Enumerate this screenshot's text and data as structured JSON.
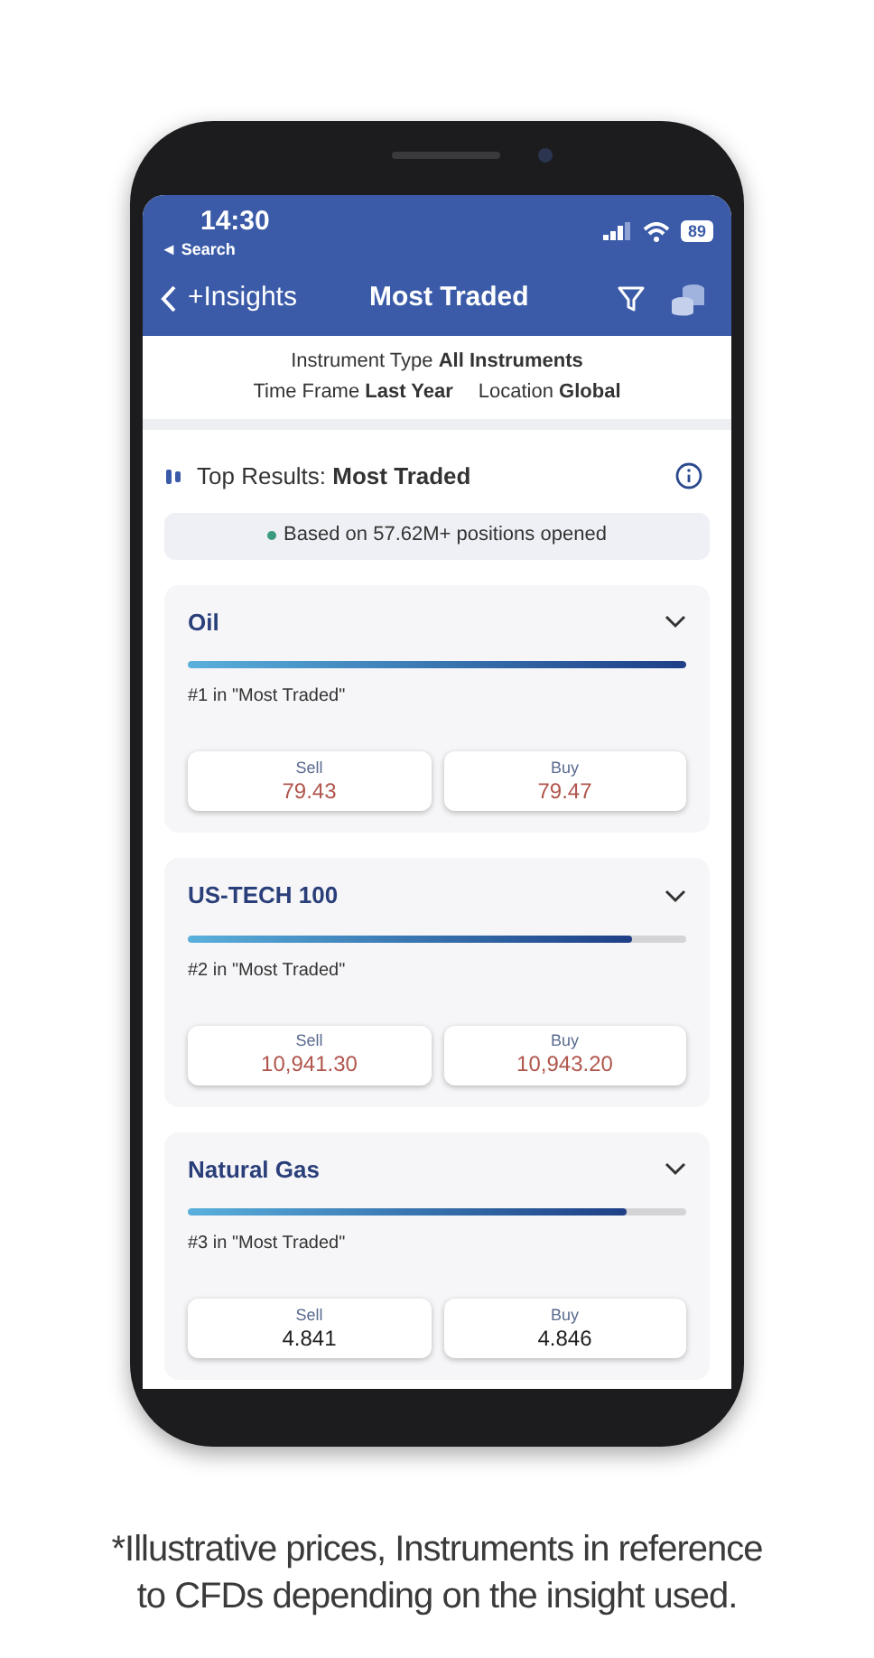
{
  "status_bar": {
    "time": "14:30",
    "back_link": "◄ Search",
    "battery": "89"
  },
  "nav": {
    "back_label": "+Insights",
    "title": "Most Traded"
  },
  "filters": {
    "instrument": "Instrument Type **All Instruments**",
    "time_frame": "Time Frame **Last Year**",
    "location": "Location **Global**"
  },
  "results": {
    "heading": "Top Results: **Most Traded**",
    "note": "Based on 57.62M+ positions opened"
  },
  "instruments": [
    {
      "name": "Oil",
      "level": 1.0,
      "rank": "#1 in \"Most Traded\"",
      "sell_label": "Sell",
      "sell": "79.43",
      "buy_label": "Buy",
      "buy": "79.47",
      "color": "#b0554c"
    },
    {
      "name": "US-TECH 100",
      "level": 0.89,
      "rank": "#2 in \"Most Traded\"",
      "sell_label": "Sell",
      "sell": "10,941.30",
      "buy_label": "Buy",
      "buy": "10,943.20",
      "color": "#b0554c"
    },
    {
      "name": "Natural Gas",
      "level": 0.88,
      "rank": "#3 in \"Most Traded\"",
      "sell_label": "Sell",
      "sell": "4.841",
      "buy_label": "Buy",
      "buy": "4.846",
      "color": "#1f1f1f"
    }
  ],
  "caption_lines": [
    "*Illustrative prices, Instruments in reference",
    "to CFDs depending on the insight used."
  ]
}
